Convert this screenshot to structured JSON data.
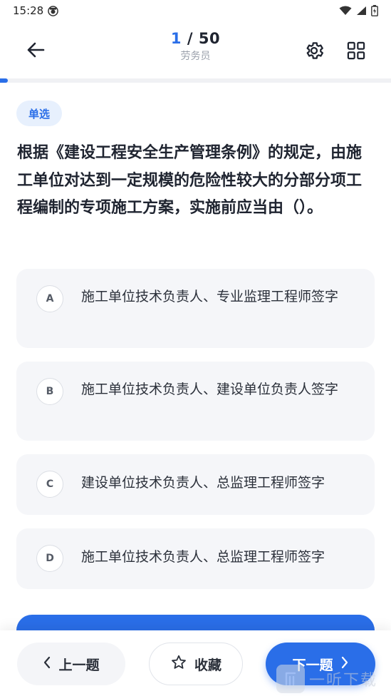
{
  "status_bar": {
    "time": "15:28"
  },
  "header": {
    "current": "1",
    "separator": " / ",
    "total": "50",
    "subject": "劳务员"
  },
  "progress": {
    "fraction": 0.02
  },
  "question": {
    "type_badge": "单选",
    "text": "根据《建设工程安全生产管理条例》的规定，由施工单位对达到一定规模的危险性较大的分部分项工程编制的专项施工方案，实施前应当由（）。",
    "options": [
      {
        "letter": "A",
        "text": "施工单位技术负责人、专业监理工程师签字"
      },
      {
        "letter": "B",
        "text": "施工单位技术负责人、建设单位负责人签字"
      },
      {
        "letter": "C",
        "text": "建设单位技术负责人、总监理工程师签字"
      },
      {
        "letter": "D",
        "text": "施工单位技术负责人、总监理工程师签字"
      }
    ]
  },
  "bottom_nav": {
    "prev_label": "上一题",
    "favorite_label": "收藏",
    "next_label": "下一题"
  },
  "watermark": {
    "text": "一听下载"
  },
  "colors": {
    "accent": "#2a6ee8",
    "badge_bg": "#e7f0fd",
    "option_bg": "#f5f6f9"
  },
  "icons": {
    "back": "arrow-left-icon",
    "settings": "gear-icon",
    "grid": "grid-icon",
    "prev": "chevron-left-icon",
    "favorite": "star-icon",
    "next": "chevron-right-icon"
  }
}
